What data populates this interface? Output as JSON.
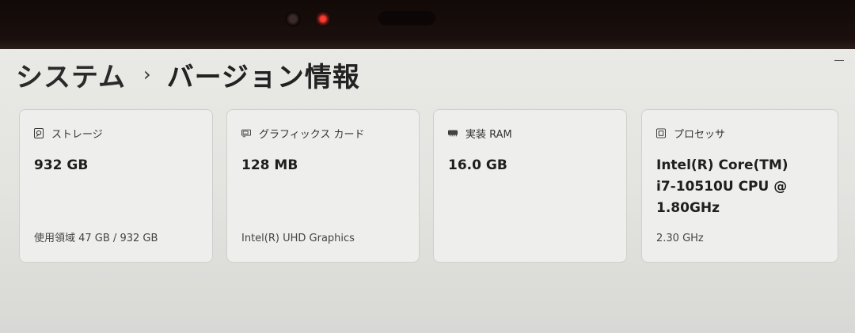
{
  "breadcrumb": {
    "parent": "システム",
    "separator": "›",
    "current": "バージョン情報"
  },
  "cards": [
    {
      "icon": "storage-icon",
      "title": "ストレージ",
      "value": "932 GB",
      "footer": "使用領域 47 GB / 932 GB"
    },
    {
      "icon": "graphics-card-icon",
      "title": "グラフィックス カード",
      "value": "128 MB",
      "footer": "Intel(R) UHD Graphics"
    },
    {
      "icon": "memory-icon",
      "title": "実装 RAM",
      "value": "16.0 GB",
      "footer": ""
    },
    {
      "icon": "processor-icon",
      "title": "プロセッサ",
      "value": "Intel(R) Core(TM)\ni7-10510U CPU @\n1.80GHz",
      "footer": "2.30 GHz"
    }
  ]
}
